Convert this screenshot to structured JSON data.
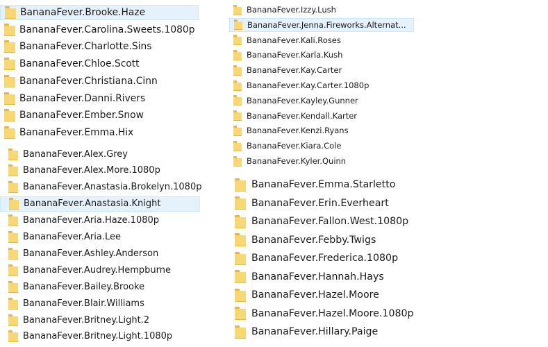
{
  "panels": {
    "top_left": {
      "selected_index": 0,
      "items": [
        "BananaFever.Brooke.Haze",
        "BananaFever.Carolina.Sweets.1080p",
        "BananaFever.Charlotte.Sins",
        "BananaFever.Chloe.Scott",
        "BananaFever.Christiana.Cinn",
        "BananaFever.Danni.Rivers",
        "BananaFever.Ember.Snow",
        "BananaFever.Emma.Hix"
      ]
    },
    "bottom_left": {
      "selected_index": 3,
      "items": [
        "BananaFever.Alex.Grey",
        "BananaFever.Alex.More.1080p",
        "BananaFever.Anastasia.Brokelyn.1080p",
        "BananaFever.Anastasia.Knight",
        "BananaFever.Aria.Haze.1080p",
        "BananaFever.Aria.Lee",
        "BananaFever.Ashley.Anderson",
        "BananaFever.Audrey.Hempburne",
        "BananaFever.Bailey.Brooke",
        "BananaFever.Blair.Williams",
        "BananaFever.Britney.Light.2",
        "BananaFever.Britney.Light.1080p"
      ]
    },
    "top_right": {
      "selected_index": 1,
      "items": [
        "BananaFever.Izzy.Lush",
        "BananaFever.Jenna.Fireworks.Alternat...",
        "BananaFever.Kali.Roses",
        "BananaFever.Karla.Kush",
        "BananaFever.Kay.Carter",
        "BananaFever.Kay.Carter.1080p",
        "BananaFever.Kayley.Gunner",
        "BananaFever.Kendall.Karter",
        "BananaFever.Kenzi.Ryans",
        "BananaFever.Kiara.Cole",
        "BananaFever.Kyler.Quinn"
      ]
    },
    "bottom_right": {
      "selected_index": -1,
      "items": [
        "BananaFever.Emma.Starletto",
        "BananaFever.Erin.Everheart",
        "BananaFever.Fallon.West.1080p",
        "BananaFever.Febby.Twigs",
        "BananaFever.Frederica.1080p",
        "BananaFever.Hannah.Hays",
        "BananaFever.Hazel.Moore",
        "BananaFever.Hazel.Moore.1080p",
        "BananaFever.Hillary.Paige"
      ]
    }
  },
  "colors": {
    "selection_bg": "#e5f1fb",
    "selection_border": "#cce8ff",
    "folder_body": "#f8d775",
    "folder_tab": "#e8b640"
  }
}
